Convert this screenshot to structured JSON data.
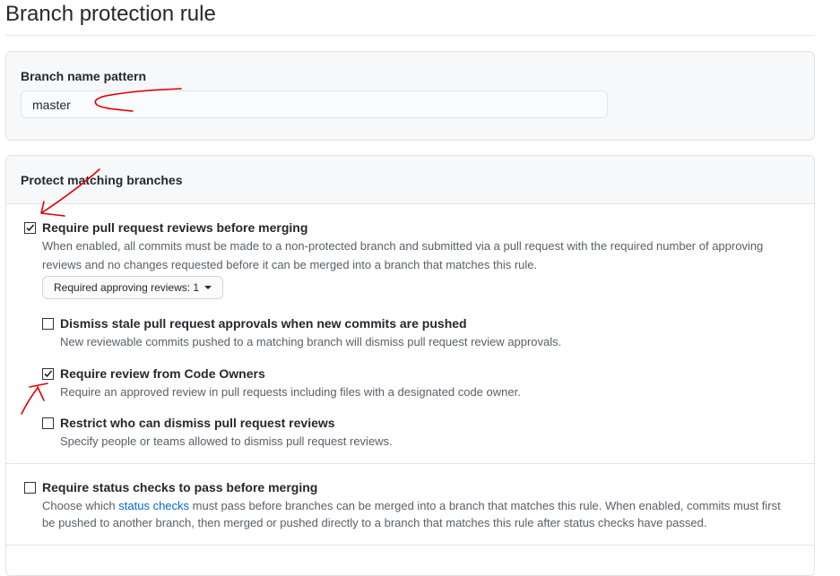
{
  "page": {
    "title": "Branch protection rule"
  },
  "pattern": {
    "label": "Branch name pattern",
    "value": "master"
  },
  "protect": {
    "header": "Protect matching branches",
    "require_reviews": {
      "label": "Require pull request reviews before merging",
      "checked": true,
      "desc_line1": "When enabled, all commits must be made to a non-protected branch and submitted via a pull request with the required number of approving",
      "desc_line2": "reviews and no changes requested before it can be merged into a branch that matches this rule.",
      "select_label": "Required approving reviews: 1"
    },
    "dismiss_stale": {
      "label": "Dismiss stale pull request approvals when new commits are pushed",
      "checked": false,
      "desc": "New reviewable commits pushed to a matching branch will dismiss pull request review approvals."
    },
    "code_owners": {
      "label": "Require review from Code Owners",
      "checked": true,
      "desc": "Require an approved review in pull requests including files with a designated code owner."
    },
    "restrict_dismiss": {
      "label": "Restrict who can dismiss pull request reviews",
      "checked": false,
      "desc": "Specify people or teams allowed to dismiss pull request reviews."
    },
    "status_checks": {
      "label": "Require status checks to pass before merging",
      "checked": false,
      "desc_prefix": "Choose which ",
      "desc_link": "status checks",
      "desc_rest1": " must pass before branches can be merged into a branch that matches this rule. When enabled, commits must first",
      "desc_line2": "be pushed to another branch, then merged or pushed directly to a branch that matches this rule after status checks have passed."
    }
  },
  "colors": {
    "link": "#0366d6",
    "annotation": "#e00000"
  },
  "icons": {
    "checked": "checkmark-icon",
    "dropdown": "caret-down-icon"
  }
}
